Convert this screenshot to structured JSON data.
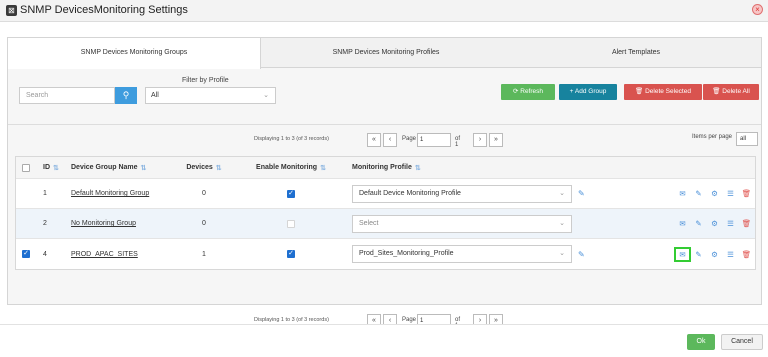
{
  "window": {
    "title": "SNMP DevicesMonitoring Settings"
  },
  "tabs": [
    {
      "label": "SNMP Devices Monitoring Groups"
    },
    {
      "label": "SNMP Devices Monitoring Profiles"
    },
    {
      "label": "Alert Templates"
    }
  ],
  "filters": {
    "filter_by_profile_label": "Filter by Profile",
    "search_placeholder": "Search",
    "profile_value": "All"
  },
  "toolbar": {
    "refresh_label": "Refresh",
    "add_group_label": "Add Group",
    "delete_selected_label": "Delete Selected",
    "delete_all_label": "Delete All"
  },
  "pager": {
    "displaying": "Displaying 1 to 3 (of 3 records)",
    "page_label": "Page",
    "page_value": "1",
    "of_label": "of 1",
    "items_per_page_label": "Items per page",
    "items_per_page_value": "all"
  },
  "table": {
    "headers": {
      "id": "ID",
      "name": "Device Group Name",
      "devices": "Devices",
      "enable": "Enable Monitoring",
      "profile": "Monitoring Profile"
    },
    "rows": [
      {
        "id": "1",
        "name": "Default Monitoring Group",
        "devices": "0",
        "profile": "Default Device Monitoring Profile"
      },
      {
        "id": "2",
        "name": "No Monitoring Group",
        "devices": "0",
        "profile": "Select"
      },
      {
        "id": "4",
        "name": "PROD_APAC_SITES",
        "devices": "1",
        "profile": "Prod_Sites_Monitoring_Profile"
      }
    ]
  },
  "footer": {
    "ok_label": "Ok",
    "cancel_label": "Cancel"
  }
}
